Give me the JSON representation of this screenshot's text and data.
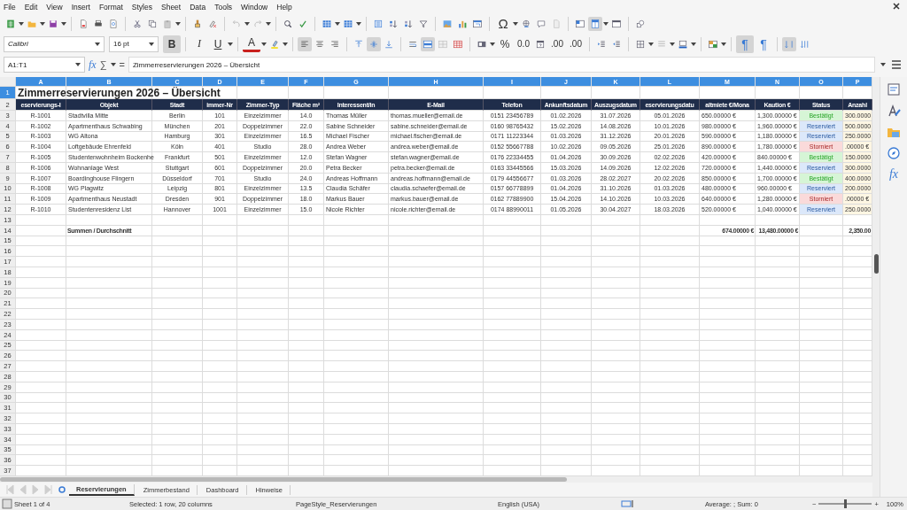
{
  "menu": [
    "File",
    "Edit",
    "View",
    "Insert",
    "Format",
    "Styles",
    "Sheet",
    "Data",
    "Tools",
    "Window",
    "Help"
  ],
  "toolbar": [
    {
      "kind": "new",
      "on": false
    },
    {
      "kind": "open",
      "on": false
    },
    {
      "kind": "save",
      "on": false
    },
    {
      "kind": "pdf",
      "on": false
    },
    {
      "kind": "print",
      "on": false
    },
    {
      "kind": "preview",
      "on": false
    },
    {
      "kind": "cut",
      "on": false
    },
    {
      "kind": "copy",
      "on": false
    },
    {
      "kind": "paste",
      "on": false
    },
    {
      "kind": "clone",
      "on": false
    },
    {
      "kind": "clear",
      "on": false
    },
    {
      "kind": "undo",
      "on": false
    },
    {
      "kind": "redo",
      "on": false
    },
    {
      "kind": "find",
      "on": false
    },
    {
      "kind": "spell",
      "on": false
    },
    {
      "kind": "row",
      "on": false
    },
    {
      "kind": "column",
      "on": false
    },
    {
      "kind": "sort",
      "on": false
    },
    {
      "kind": "sortasc",
      "on": false
    },
    {
      "kind": "sortdesc",
      "on": false
    },
    {
      "kind": "filter",
      "on": false
    },
    {
      "kind": "image",
      "on": false
    },
    {
      "kind": "chart",
      "on": false
    },
    {
      "kind": "pivot",
      "on": false
    },
    {
      "kind": "special",
      "label": "Ω",
      "on": false
    },
    {
      "kind": "link",
      "on": false
    },
    {
      "kind": "comment",
      "on": false
    },
    {
      "kind": "header",
      "on": false
    },
    {
      "kind": "freeze",
      "on": false
    },
    {
      "kind": "split",
      "on": true
    },
    {
      "kind": "window",
      "on": false
    },
    {
      "kind": "shapes",
      "on": false
    }
  ],
  "format_bar": {
    "font_name": "Calibri",
    "font_size": "16 pt",
    "buttons": [
      {
        "kind": "bold",
        "label": "B",
        "on": true
      },
      {
        "kind": "italic",
        "label": "I",
        "on": false
      },
      {
        "kind": "underline",
        "label": "U",
        "on": false
      },
      {
        "kind": "font-color",
        "label": "A",
        "on": false
      },
      {
        "kind": "highlight",
        "on": false
      },
      {
        "kind": "align-left",
        "on": true
      },
      {
        "kind": "align-center",
        "on": false
      },
      {
        "kind": "align-right",
        "on": false
      },
      {
        "kind": "align-top",
        "on": false
      },
      {
        "kind": "align-middle",
        "on": true
      },
      {
        "kind": "align-bottom",
        "on": false
      },
      {
        "kind": "wrap",
        "on": false
      },
      {
        "kind": "merge",
        "on": true
      },
      {
        "kind": "unmerge",
        "on": false
      },
      {
        "kind": "table",
        "on": false
      },
      {
        "kind": "number-format",
        "on": false
      },
      {
        "kind": "percent",
        "label": "%",
        "on": false
      },
      {
        "kind": "decimal",
        "label": "0.0",
        "on": false
      },
      {
        "kind": "date",
        "on": false
      },
      {
        "kind": "add-decimal",
        "label": ".00",
        "on": false
      },
      {
        "kind": "remove-decimal",
        "label": ".00",
        "on": false
      },
      {
        "kind": "indent",
        "on": false
      },
      {
        "kind": "outdent",
        "on": false
      },
      {
        "kind": "borders",
        "on": false
      },
      {
        "kind": "border-style",
        "on": false
      },
      {
        "kind": "border-color",
        "on": false
      },
      {
        "kind": "conditional",
        "on": false
      },
      {
        "kind": "ltr",
        "label": "¶",
        "on": true
      },
      {
        "kind": "rtl",
        "label": "¶",
        "on": false
      },
      {
        "kind": "stack",
        "on": true
      },
      {
        "kind": "sort-text",
        "on": false
      }
    ]
  },
  "formula_bar": {
    "cell_ref": "A1:T1",
    "function_label": "fx",
    "sum_label": "∑",
    "equals_label": "=",
    "content": "Zimmerreservierungen 2026 – Übersicht"
  },
  "grid": {
    "columns": [
      {
        "label": "A",
        "selected": true
      },
      {
        "label": "B",
        "selected": true
      },
      {
        "label": "C",
        "selected": true
      },
      {
        "label": "D",
        "selected": true
      },
      {
        "label": "E",
        "selected": true
      },
      {
        "label": "F",
        "selected": true
      },
      {
        "label": "G",
        "selected": true
      },
      {
        "label": "H",
        "selected": true
      },
      {
        "label": "I",
        "selected": true
      },
      {
        "label": "J",
        "selected": true
      },
      {
        "label": "K",
        "selected": true
      },
      {
        "label": "L",
        "selected": true
      },
      {
        "label": "M",
        "selected": true
      },
      {
        "label": "N",
        "selected": true
      },
      {
        "label": "O",
        "selected": true
      },
      {
        "label": "P",
        "selected": true
      }
    ],
    "title_row": {
      "number": "1",
      "selected": true,
      "text": "Zimmerreservierungen 2026 – Übersicht"
    },
    "header_row": {
      "number": "2",
      "selected": false,
      "cells": [
        "eservierungs-I",
        "Objekt",
        "Stadt",
        "immer-Nr",
        "Zimmer-Typ",
        "Fläche m²",
        "Interessent/in",
        "E-Mail",
        "Telefon",
        "Ankunftsdatum",
        "Auszugsdatum",
        "eservierungsdatu",
        "altmiete €/Mona",
        "Kaution €",
        "Status",
        "Anzahl"
      ]
    },
    "rows": [
      {
        "kind": "data",
        "number": "3",
        "selected": false,
        "cells": [
          "R-1001",
          "Stadtvilla Mitte",
          "Berlin",
          "101",
          "Einzelzimmer",
          "14.0",
          "Thomas Müller",
          "thomas.mueller@email.de",
          "0151 23456789",
          "01.02.2026",
          "31.07.2026",
          "05.01.2026",
          "650.00000 €",
          "1,300.00000 €"
        ],
        "status": {
          "text": "Bestätigt",
          "color": "#d6f5d6"
        },
        "deposit": "300.0000"
      },
      {
        "kind": "data",
        "number": "4",
        "selected": false,
        "cells": [
          "R-1002",
          "Apartmenthaus Schwabing",
          "München",
          "201",
          "Doppelzimmer",
          "22.0",
          "Sabine Schneider",
          "sabine.schneider@email.de",
          "0160 98765432",
          "15.02.2026",
          "14.08.2026",
          "10.01.2026",
          "980.00000 €",
          "1,960.00000 €"
        ],
        "status": {
          "text": "Reserviert",
          "color": "#dce8fa"
        },
        "deposit": "500.0000"
      },
      {
        "kind": "data",
        "number": "5",
        "selected": false,
        "cells": [
          "R-1003",
          "WG Altona",
          "Hamburg",
          "301",
          "Einzelzimmer",
          "16.5",
          "Michael Fischer",
          "michael.fischer@email.de",
          "0171 11223344",
          "01.03.2026",
          "31.12.2026",
          "20.01.2026",
          "590.00000 €",
          "1,180.00000 €"
        ],
        "status": {
          "text": "Reserviert",
          "color": "#dce8fa"
        },
        "deposit": "250.0000"
      },
      {
        "kind": "data",
        "number": "6",
        "selected": false,
        "cells": [
          "R-1004",
          "Loftgebäude Ehrenfeld",
          "Köln",
          "401",
          "Studio",
          "28.0",
          "Andrea Weber",
          "andrea.weber@email.de",
          "0152 55667788",
          "10.02.2026",
          "09.05.2026",
          "25.01.2026",
          "890.00000 €",
          "1,780.00000 €"
        ],
        "status": {
          "text": "Storniert",
          "color": "#fadada"
        },
        "deposit": ".00000 €"
      },
      {
        "kind": "data",
        "number": "7",
        "selected": false,
        "cells": [
          "R-1005",
          "Studentenwohnheim Bockenhe",
          "Frankfurt",
          "501",
          "Einzelzimmer",
          "12.0",
          "Stefan Wagner",
          "stefan.wagner@email.de",
          "0176 22334455",
          "01.04.2026",
          "30.09.2026",
          "02.02.2026",
          "420.00000 €",
          "840.00000 €"
        ],
        "status": {
          "text": "Bestätigt",
          "color": "#d6f5d6"
        },
        "deposit": "150.0000"
      },
      {
        "kind": "data",
        "number": "8",
        "selected": false,
        "cells": [
          "R-1006",
          "Wohnanlage West",
          "Stuttgart",
          "601",
          "Doppelzimmer",
          "20.0",
          "Petra Becker",
          "petra.becker@email.de",
          "0163 33445566",
          "15.03.2026",
          "14.09.2026",
          "12.02.2026",
          "720.00000 €",
          "1,440.00000 €"
        ],
        "status": {
          "text": "Reserviert",
          "color": "#dce8fa"
        },
        "deposit": "300.0000"
      },
      {
        "kind": "data",
        "number": "9",
        "selected": false,
        "cells": [
          "R-1007",
          "Boardinghouse Flingern",
          "Düsseldorf",
          "701",
          "Studio",
          "24.0",
          "Andreas Hoffmann",
          "andreas.hoffmann@email.de",
          "0179 44556677",
          "01.03.2026",
          "28.02.2027",
          "20.02.2026",
          "850.00000 €",
          "1,700.00000 €"
        ],
        "status": {
          "text": "Bestätigt",
          "color": "#d6f5d6"
        },
        "deposit": "400.0000"
      },
      {
        "kind": "data",
        "number": "10",
        "selected": false,
        "cells": [
          "R-1008",
          "WG Plagwitz",
          "Leipzig",
          "801",
          "Einzelzimmer",
          "13.5",
          "Claudia Schäfer",
          "claudia.schaefer@email.de",
          "0157 66778899",
          "01.04.2026",
          "31.10.2026",
          "01.03.2026",
          "480.00000 €",
          "960.00000 €"
        ],
        "status": {
          "text": "Reserviert",
          "color": "#dce8fa"
        },
        "deposit": "200.0000"
      },
      {
        "kind": "data",
        "number": "11",
        "selected": false,
        "cells": [
          "R-1009",
          "Apartmenthaus Neustadt",
          "Dresden",
          "901",
          "Doppelzimmer",
          "18.0",
          "Markus Bauer",
          "markus.bauer@email.de",
          "0162 77889900",
          "15.04.2026",
          "14.10.2026",
          "10.03.2026",
          "640.00000 €",
          "1,280.00000 €"
        ],
        "status": {
          "text": "Storniert",
          "color": "#fadada"
        },
        "deposit": ".00000 €"
      },
      {
        "kind": "data",
        "number": "12",
        "selected": false,
        "cells": [
          "R-1010",
          "Studentenresidenz List",
          "Hannover",
          "1001",
          "Einzelzimmer",
          "15.0",
          "Nicole Richter",
          "nicole.richter@email.de",
          "0174 88990011",
          "01.05.2026",
          "30.04.2027",
          "18.03.2026",
          "520.00000 €",
          "1,040.00000 €"
        ],
        "status": {
          "text": "Reserviert",
          "color": "#dce8fa"
        },
        "deposit": "250.0000"
      },
      {
        "kind": "blank",
        "number": "13",
        "selected": false
      },
      {
        "kind": "total",
        "number": "14",
        "selected": false,
        "label": "Summen / Durchschnitt",
        "rent_total": "674.00000 €",
        "deposit_total": "13,480.00000 €",
        "advance_total": "2,350.00"
      },
      {
        "kind": "blank",
        "number": "15",
        "selected": false
      },
      {
        "kind": "blank",
        "number": "16",
        "selected": false
      },
      {
        "kind": "blank",
        "number": "17",
        "selected": false
      },
      {
        "kind": "blank",
        "number": "18",
        "selected": false
      },
      {
        "kind": "blank",
        "number": "19",
        "selected": false
      },
      {
        "kind": "blank",
        "number": "20",
        "selected": false
      },
      {
        "kind": "blank",
        "number": "21",
        "selected": false
      },
      {
        "kind": "blank",
        "number": "22",
        "selected": false
      },
      {
        "kind": "blank",
        "number": "23",
        "selected": false
      },
      {
        "kind": "blank",
        "number": "24",
        "selected": false
      },
      {
        "kind": "blank",
        "number": "25",
        "selected": false
      },
      {
        "kind": "blank",
        "number": "26",
        "selected": false
      },
      {
        "kind": "blank",
        "number": "27",
        "selected": false
      },
      {
        "kind": "blank",
        "number": "28",
        "selected": false
      },
      {
        "kind": "blank",
        "number": "29",
        "selected": false
      },
      {
        "kind": "blank",
        "number": "30",
        "selected": false
      },
      {
        "kind": "blank",
        "number": "31",
        "selected": false
      },
      {
        "kind": "blank",
        "number": "32",
        "selected": false
      },
      {
        "kind": "blank",
        "number": "33",
        "selected": false
      },
      {
        "kind": "blank",
        "number": "34",
        "selected": false
      },
      {
        "kind": "blank",
        "number": "35",
        "selected": false
      },
      {
        "kind": "blank",
        "number": "36",
        "selected": false
      },
      {
        "kind": "blank",
        "number": "37",
        "selected": false
      }
    ]
  },
  "sidebar": {
    "function_label": "fx"
  },
  "sheet_tabs": [
    {
      "label": "Reservierungen",
      "selected": true
    },
    {
      "label": "Zimmerbestand",
      "selected": false
    },
    {
      "label": "Dashboard",
      "selected": false
    },
    {
      "label": "Hinweise",
      "selected": false
    }
  ],
  "status_bar": {
    "sheet_info": "Sheet 1 of 4",
    "selection": "Selected: 1 row, 20 columns",
    "page_style": "PageStyle_Reservierungen",
    "language": "English (USA)",
    "summary": "Average: ; Sum: 0",
    "zoom_out": "−",
    "zoom_in": "+",
    "zoom": {
      "level": 0.5
    },
    "zoom_percent": "100%"
  }
}
